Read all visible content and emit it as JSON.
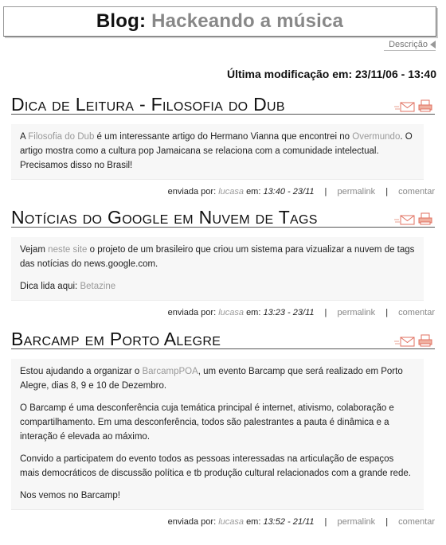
{
  "header": {
    "prefix": "Blog:",
    "name": "Hackeando a música"
  },
  "descricao_label": "Descrição",
  "last_modified": "Última modificação em: 23/11/06 - 13:40",
  "footer_labels": {
    "sent_by": "enviada por:",
    "at": "em:",
    "permalink": "permalink",
    "comment": "comentar",
    "separator": "|"
  },
  "posts": [
    {
      "title": "Dica de Leitura - Filosofia do Dub",
      "author": "lucasa",
      "datetime": "13:40 - 23/11",
      "p1": {
        "t1": "A ",
        "l1": "Filosofia do Dub",
        "t2": " é um interessante artigo do Hermano Vianna que encontrei no ",
        "l2": "Overmundo",
        "t3": ". O artigo mostra como a cultura pop Jamaicana se relaciona com a comunidade intelectual. Precisamos disso no Brasil!"
      }
    },
    {
      "title": "Notícias do Google em Nuvem de Tags",
      "author": "lucasa",
      "datetime": "13:23 - 23/11",
      "p1": {
        "t1": "Vejam ",
        "l1": "neste site",
        "t2": " o projeto de um brasileiro que criou um sistema para vizualizar a nuvem de tags das notícias do news.google.com."
      },
      "p2": {
        "t1": "Dica lida aqui: ",
        "l1": "Betazine"
      }
    },
    {
      "title": "Barcamp em Porto Alegre",
      "author": "lucasa",
      "datetime": "13:52 - 21/11",
      "p1": {
        "t1": "Estou ajudando a organizar o ",
        "l1": "BarcampPOA",
        "t2": ", um evento Barcamp que será realizado em Porto Alegre, dias 8, 9 e 10 de Dezembro."
      },
      "p2": "O Barcamp é uma desconferência cuja temática principal é internet, ativismo, colaboração e compartilhamento. Em uma desconferência, todos são palestrantes a pauta é dinâmica e a interação é elevada ao máximo.",
      "p3": "Convido a participatem do evento todos as pessoas interessadas na articulação de espaços mais democráticos de discussão política e tb produção cultural relacionados com a grande rede.",
      "p4": "Nos vemos no Barcamp!"
    }
  ],
  "icons": {
    "email": "email-icon",
    "print": "print-icon",
    "accent_color": "#e07060"
  }
}
